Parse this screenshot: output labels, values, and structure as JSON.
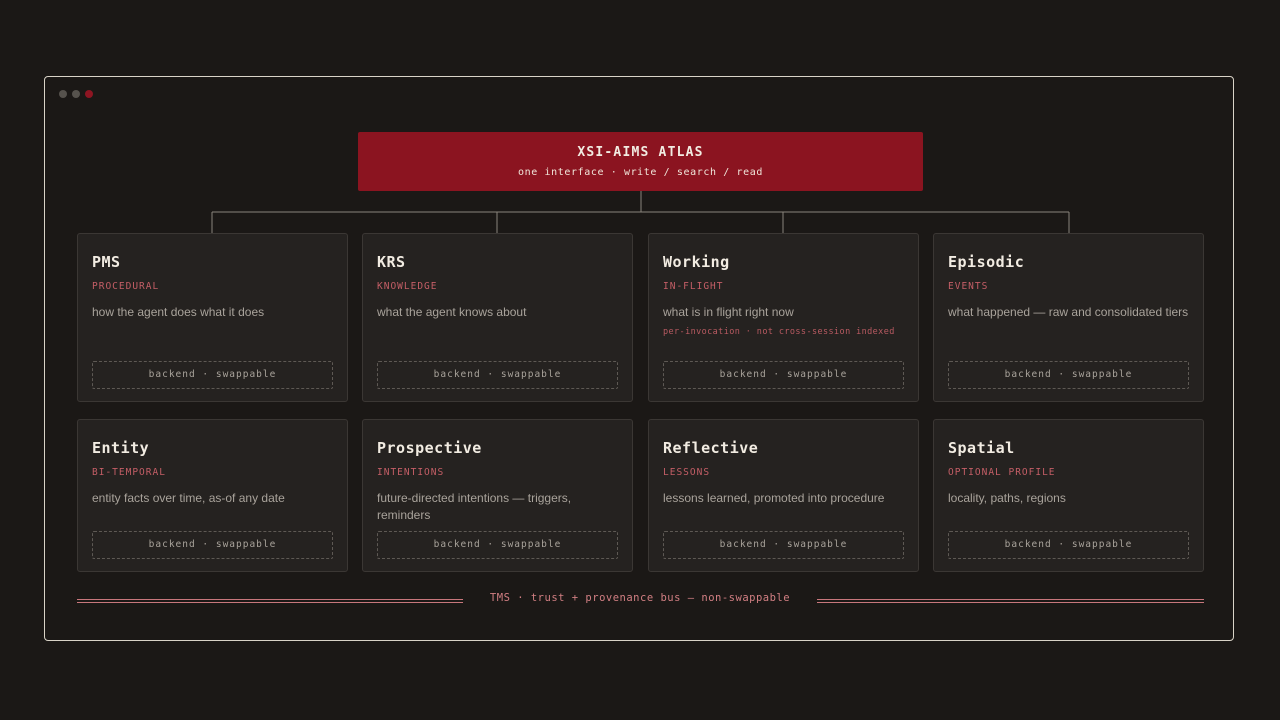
{
  "root": {
    "title": "XSI-AIMS ATLAS",
    "subtitle": "one interface · write / search / read"
  },
  "modules": [
    {
      "name": "PMS",
      "tag": "PROCEDURAL",
      "description": "how the agent does what it does",
      "note": "",
      "backend": "backend · swappable"
    },
    {
      "name": "KRS",
      "tag": "KNOWLEDGE",
      "description": "what the agent knows about",
      "note": "",
      "backend": "backend · swappable"
    },
    {
      "name": "Working",
      "tag": "IN-FLIGHT",
      "description": "what is in flight right now",
      "note": "per-invocation · not cross-session indexed",
      "backend": "backend · swappable"
    },
    {
      "name": "Episodic",
      "tag": "EVENTS",
      "description": "what happened — raw and consolidated tiers",
      "note": "",
      "backend": "backend · swappable"
    },
    {
      "name": "Entity",
      "tag": "BI-TEMPORAL",
      "description": "entity facts over time, as-of any date",
      "note": "",
      "backend": "backend · swappable"
    },
    {
      "name": "Prospective",
      "tag": "INTENTIONS",
      "description": "future-directed intentions — triggers, reminders",
      "note": "",
      "backend": "backend · swappable"
    },
    {
      "name": "Reflective",
      "tag": "LESSONS",
      "description": "lessons learned, promoted into procedure",
      "note": "",
      "backend": "backend · swappable"
    },
    {
      "name": "Spatial",
      "tag": "OPTIONAL PROFILE",
      "description": "locality, paths, regions",
      "note": "",
      "backend": "backend · swappable"
    }
  ],
  "bus": {
    "label": "TMS · trust + provenance bus — non-swappable"
  },
  "colors": {
    "background": "#1b1816",
    "root": "#8b1420",
    "accent": "#c45e66",
    "card": "#252220"
  }
}
